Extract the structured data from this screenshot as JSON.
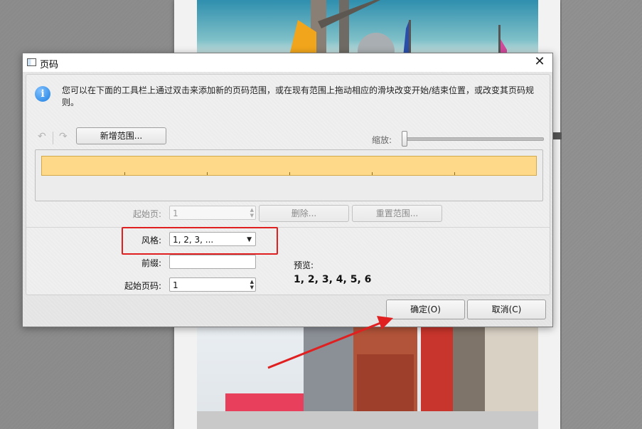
{
  "dialog": {
    "title": "页码",
    "close_glyph": "✕",
    "info_text": "您可以在下面的工具栏上通过双击来添加新的页码范围，或在现有范围上拖动相应的滑块改变开始/结束位置，或改变其页码规则。",
    "toolbar": {
      "undo_glyph": "↶",
      "redo_glyph": "↷",
      "add_range_label": "新增范围...",
      "zoom_label": "缩放:"
    },
    "range": {
      "start_page_label": "起始页:",
      "start_page_value": "1",
      "delete_label": "删除...",
      "reset_label": "重置范围..."
    },
    "format": {
      "style_label": "风格:",
      "style_value": "1, 2, 3, ...",
      "prefix_label": "前缀:",
      "prefix_value": "",
      "start_number_label": "起始页码:",
      "start_number_value": "1",
      "preview_label": "预览:",
      "preview_value": "1, 2, 3, 4, 5, 6"
    },
    "buttons": {
      "ok_label": "确定(O)",
      "cancel_label": "取消(C)"
    }
  },
  "colors": {
    "highlight": "#e02020",
    "range_bar": "#ffd98a"
  }
}
